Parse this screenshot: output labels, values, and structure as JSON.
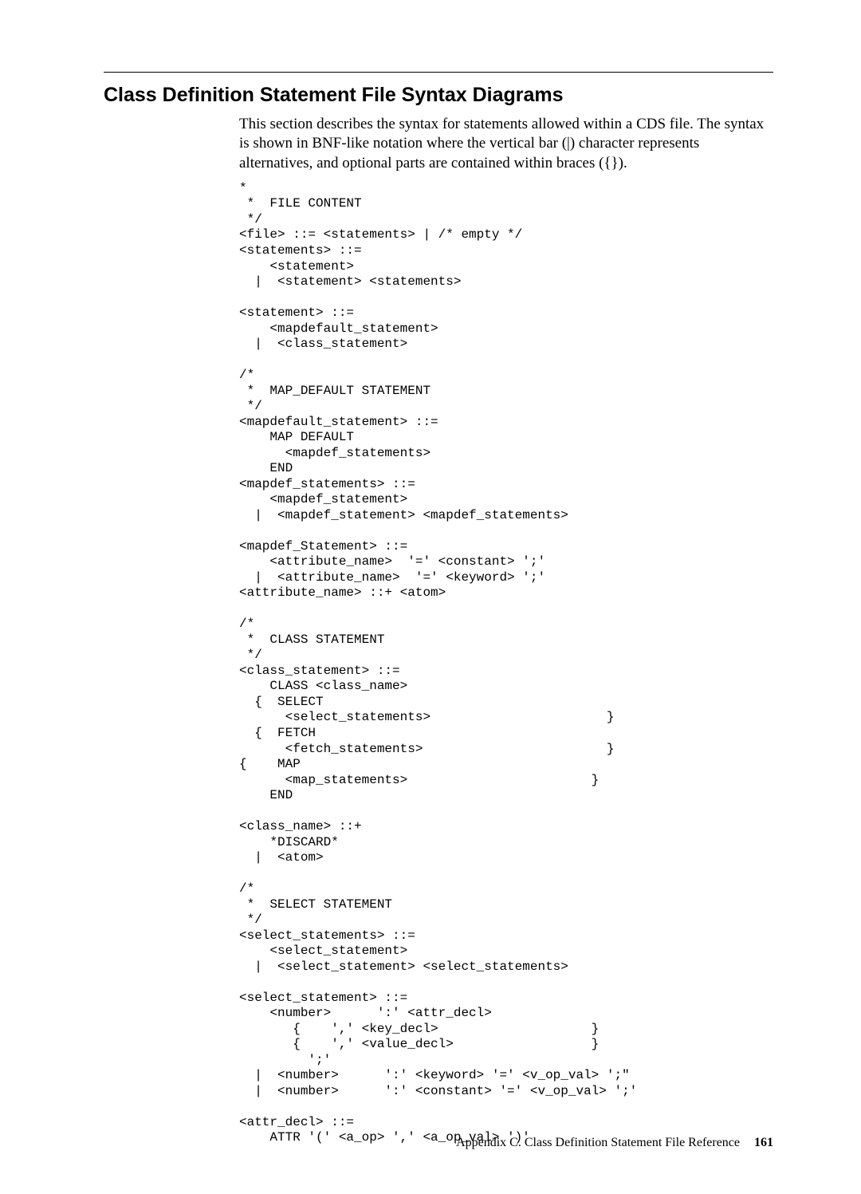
{
  "heading": "Class Definition Statement File Syntax Diagrams",
  "intro": "This section describes the syntax for statements allowed within a CDS file. The syntax is shown in BNF-like notation where the vertical bar (|) character represents alternatives, and optional parts are contained within braces ({}).",
  "code": "*\n *  FILE CONTENT\n */\n<file> ::= <statements> | /* empty */\n<statements> ::=\n    <statement>\n  |  <statement> <statements>\n\n<statement> ::=\n    <mapdefault_statement>\n  |  <class_statement>\n\n/*\n *  MAP_DEFAULT STATEMENT\n */\n<mapdefault_statement> ::=\n    MAP DEFAULT\n      <mapdef_statements>\n    END\n<mapdef_statements> ::=\n    <mapdef_statement>\n  |  <mapdef_statement> <mapdef_statements>\n\n<mapdef_Statement> ::=\n    <attribute_name>  '=' <constant> ';'\n  |  <attribute_name>  '=' <keyword> ';'\n<attribute_name> ::+ <atom>\n\n/*\n *  CLASS STATEMENT\n */\n<class_statement> ::=\n    CLASS <class_name>\n  {  SELECT\n      <select_statements>                       }\n  {  FETCH\n      <fetch_statements>                        }\n{    MAP\n      <map_statements>                        }\n    END\n\n<class_name> ::+\n    *DISCARD*\n  |  <atom>\n\n/*\n *  SELECT STATEMENT\n */\n<select_statements> ::=\n    <select_statement>\n  |  <select_statement> <select_statements>\n\n<select_statement> ::=\n    <number>      ':' <attr_decl>\n       {    ',' <key_decl>                    }\n       {    ',' <value_decl>                  }\n         ';'\n  |  <number>      ':' <keyword> '=' <v_op_val> ';\"\n  |  <number>      ':' <constant> '=' <v_op_val> ';'\n\n<attr_decl> ::=\n    ATTR '(' <a_op> ',' <a_op_val> ')'",
  "footer_text": "Appendix C. Class Definition Statement File Reference",
  "footer_page": "161"
}
